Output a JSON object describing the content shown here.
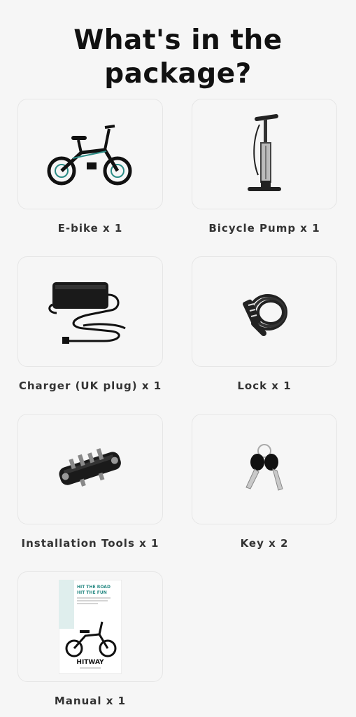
{
  "heading": {
    "line1": "What's in the",
    "line2": "package?"
  },
  "items": [
    {
      "label": "E-bike x 1",
      "icon": "ebike-icon"
    },
    {
      "label": "Bicycle Pump x 1",
      "icon": "bicycle-pump-icon"
    },
    {
      "label": "Charger (UK plug) x 1",
      "icon": "charger-icon"
    },
    {
      "label": "Lock x 1",
      "icon": "lock-icon"
    },
    {
      "label": "Installation Tools x 1",
      "icon": "multi-tool-icon"
    },
    {
      "label": "Key x 2",
      "icon": "keys-icon"
    },
    {
      "label": "Manual x 1",
      "icon": "manual-icon"
    }
  ],
  "manual": {
    "headline1": "HIT THE ROAD",
    "headline2": "HIT THE FUN",
    "brand": "HITWAY"
  },
  "colors": {
    "accent": "#2c8c86",
    "text": "#111111"
  }
}
